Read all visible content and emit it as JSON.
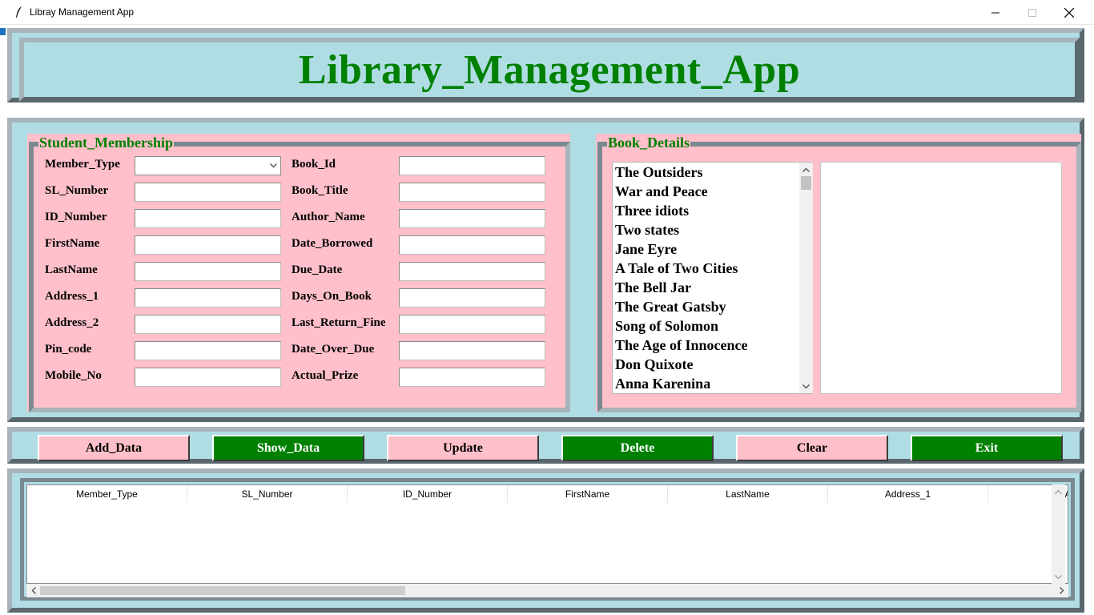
{
  "window": {
    "title": "Libray Management App"
  },
  "header": {
    "title": "Library_Management_App"
  },
  "membership": {
    "title": "Student_Membership",
    "fields_left": [
      {
        "label": "Member_Type",
        "value": ""
      },
      {
        "label": "SL_Number",
        "value": ""
      },
      {
        "label": "ID_Number",
        "value": ""
      },
      {
        "label": "FirstName",
        "value": ""
      },
      {
        "label": "LastName",
        "value": ""
      },
      {
        "label": "Address_1",
        "value": ""
      },
      {
        "label": "Address_2",
        "value": ""
      },
      {
        "label": "Pin_code",
        "value": ""
      },
      {
        "label": "Mobile_No",
        "value": ""
      }
    ],
    "fields_right": [
      {
        "label": "Book_Id",
        "value": ""
      },
      {
        "label": "Book_Title",
        "value": ""
      },
      {
        "label": "Author_Name",
        "value": ""
      },
      {
        "label": "Date_Borrowed",
        "value": ""
      },
      {
        "label": "Due_Date",
        "value": ""
      },
      {
        "label": "Days_On_Book",
        "value": ""
      },
      {
        "label": "Last_Return_Fine",
        "value": ""
      },
      {
        "label": "Date_Over_Due",
        "value": ""
      },
      {
        "label": "Actual_Prize",
        "value": ""
      }
    ]
  },
  "book_details": {
    "title": "Book_Details",
    "books": [
      "The Outsiders",
      "War and Peace",
      "Three idiots",
      "Two states",
      "Jane Eyre",
      "A Tale of Two Cities",
      "The Bell Jar",
      "The Great Gatsby",
      "Song of Solomon",
      "The Age of Innocence",
      "Don Quixote",
      "Anna Karenina"
    ],
    "details_text": ""
  },
  "actions": {
    "add": "Add_Data",
    "show": "Show_Data",
    "update": "Update",
    "delete": "Delete",
    "clear": "Clear",
    "exit": "Exit"
  },
  "table": {
    "columns": [
      "Member_Type",
      "SL_Number",
      "ID_Number",
      "FirstName",
      "LastName",
      "Address_1",
      "A"
    ]
  },
  "colors": {
    "frame_bg": "#b0dde4",
    "panel_bg": "#ffc0cb",
    "accent_green": "#008000"
  }
}
